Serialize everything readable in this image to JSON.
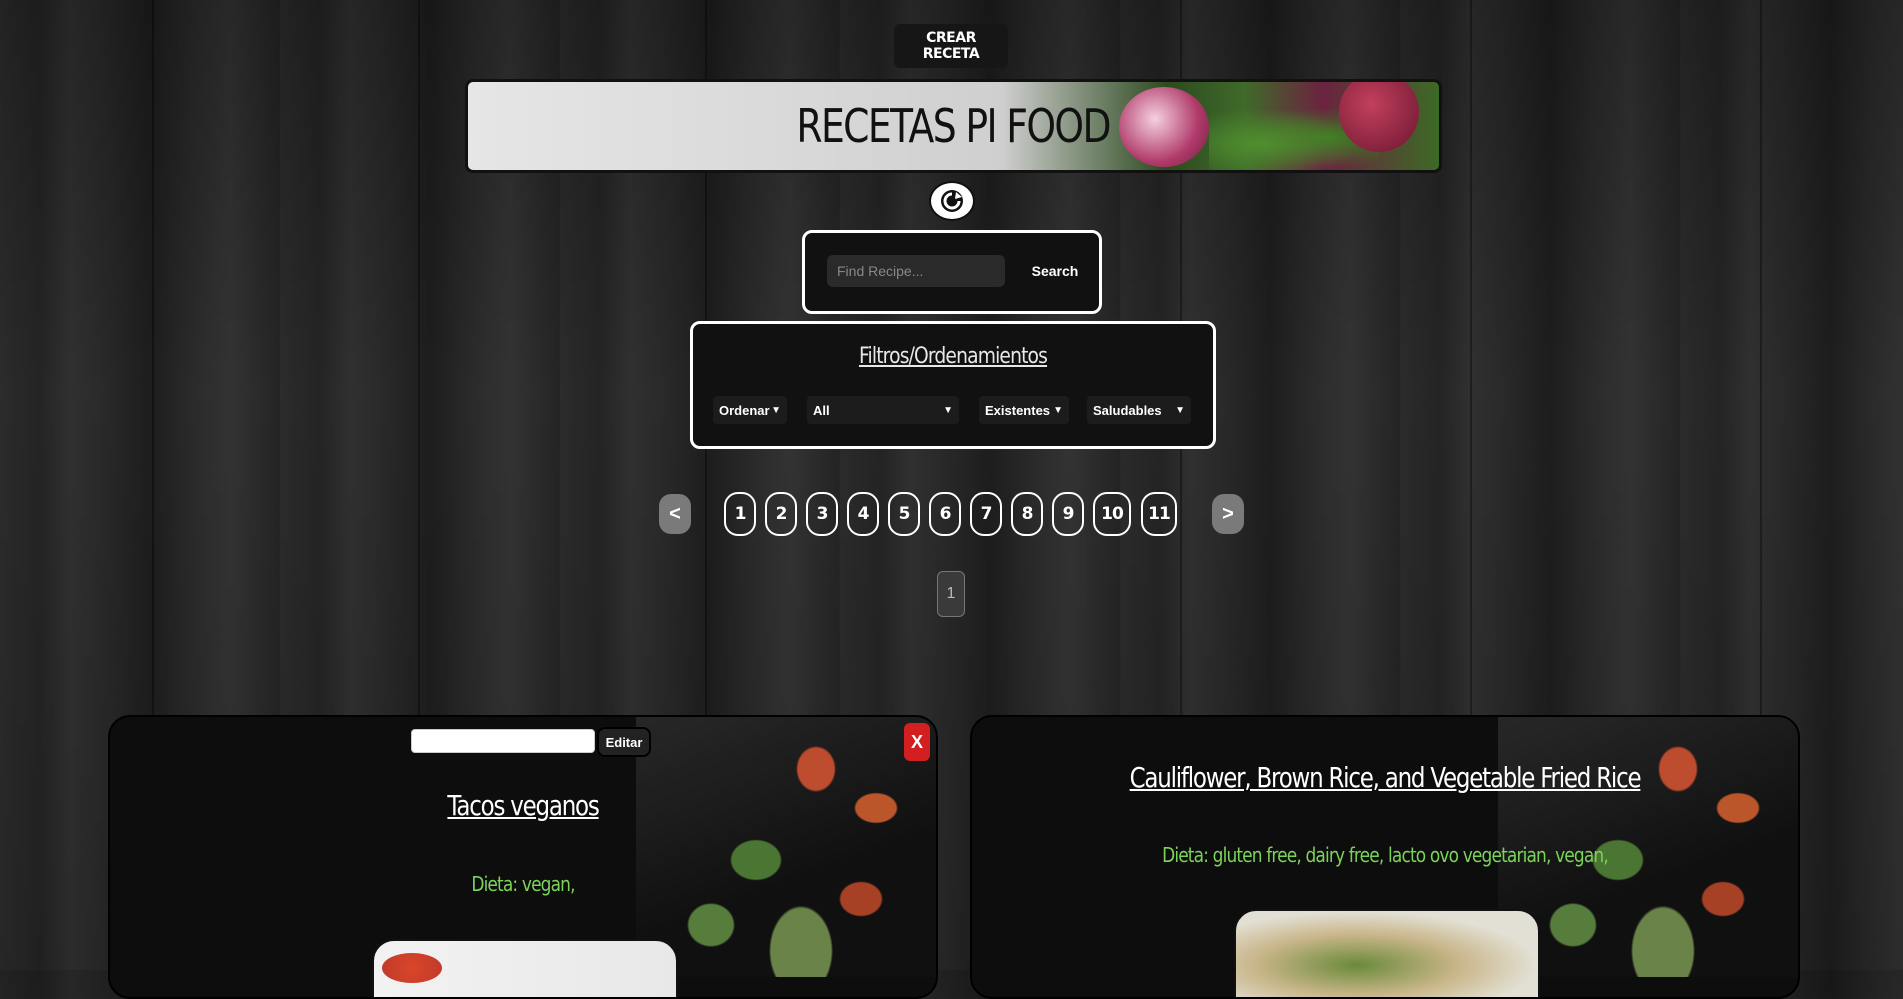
{
  "header": {
    "create_button_label": "CREAR RECETA",
    "banner_title": "RECETAS PI FOOD"
  },
  "refresh": {
    "icon": "refresh-icon"
  },
  "search": {
    "placeholder": "Find Recipe...",
    "button_label": "Search"
  },
  "filters": {
    "title": "Filtros/Ordenamientos",
    "selects": [
      {
        "value": "Ordenar"
      },
      {
        "value": "All"
      },
      {
        "value": "Existentes"
      },
      {
        "value": "Saludables"
      }
    ]
  },
  "pagination": {
    "prev_label": "<",
    "next_label": ">",
    "pages": [
      "1",
      "2",
      "3",
      "4",
      "5",
      "6",
      "7",
      "8",
      "9",
      "10",
      "11"
    ],
    "current": "1"
  },
  "recipes": [
    {
      "title": "Tacos veganos",
      "diet": "Dieta: vegan,",
      "edit_label": "Editar",
      "delete_label": "X"
    },
    {
      "title": "Cauliflower, Brown Rice, and Vegetable Fried Rice",
      "diet": "Dieta: gluten free, dairy free, lacto ovo vegetarian, vegan,"
    }
  ]
}
